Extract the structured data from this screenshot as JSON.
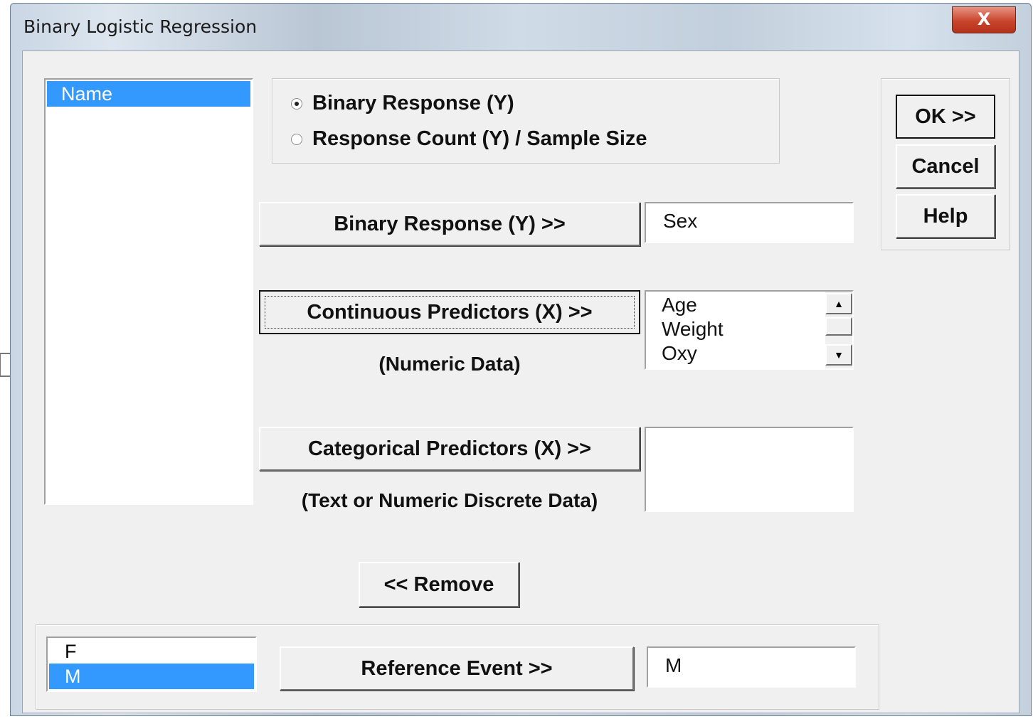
{
  "window": {
    "title": "Binary Logistic Regression",
    "close_glyph": "X"
  },
  "variables_list": {
    "items": [
      {
        "label": "Name",
        "selected": true
      }
    ]
  },
  "response_type": {
    "options": [
      {
        "label": "Binary Response (Y)",
        "checked": true
      },
      {
        "label": "Response Count (Y) / Sample Size",
        "checked": false
      }
    ]
  },
  "binary_response": {
    "button_label": "Binary Response (Y) >>",
    "value": "Sex"
  },
  "continuous_predictors": {
    "button_label": "Continuous Predictors (X) >>",
    "caption": "(Numeric Data)",
    "items": [
      "Age",
      "Weight",
      "Oxy"
    ]
  },
  "categorical_predictors": {
    "button_label": "Categorical Predictors (X) >>",
    "caption": "(Text or Numeric Discrete Data)",
    "items": []
  },
  "remove_button": {
    "label": "<< Remove"
  },
  "side_buttons": {
    "ok": "OK >>",
    "cancel": "Cancel",
    "help": "Help"
  },
  "reference_event": {
    "levels": [
      {
        "label": "F",
        "selected": false
      },
      {
        "label": "M",
        "selected": true
      }
    ],
    "button_label": "Reference Event >>",
    "value": "M"
  }
}
